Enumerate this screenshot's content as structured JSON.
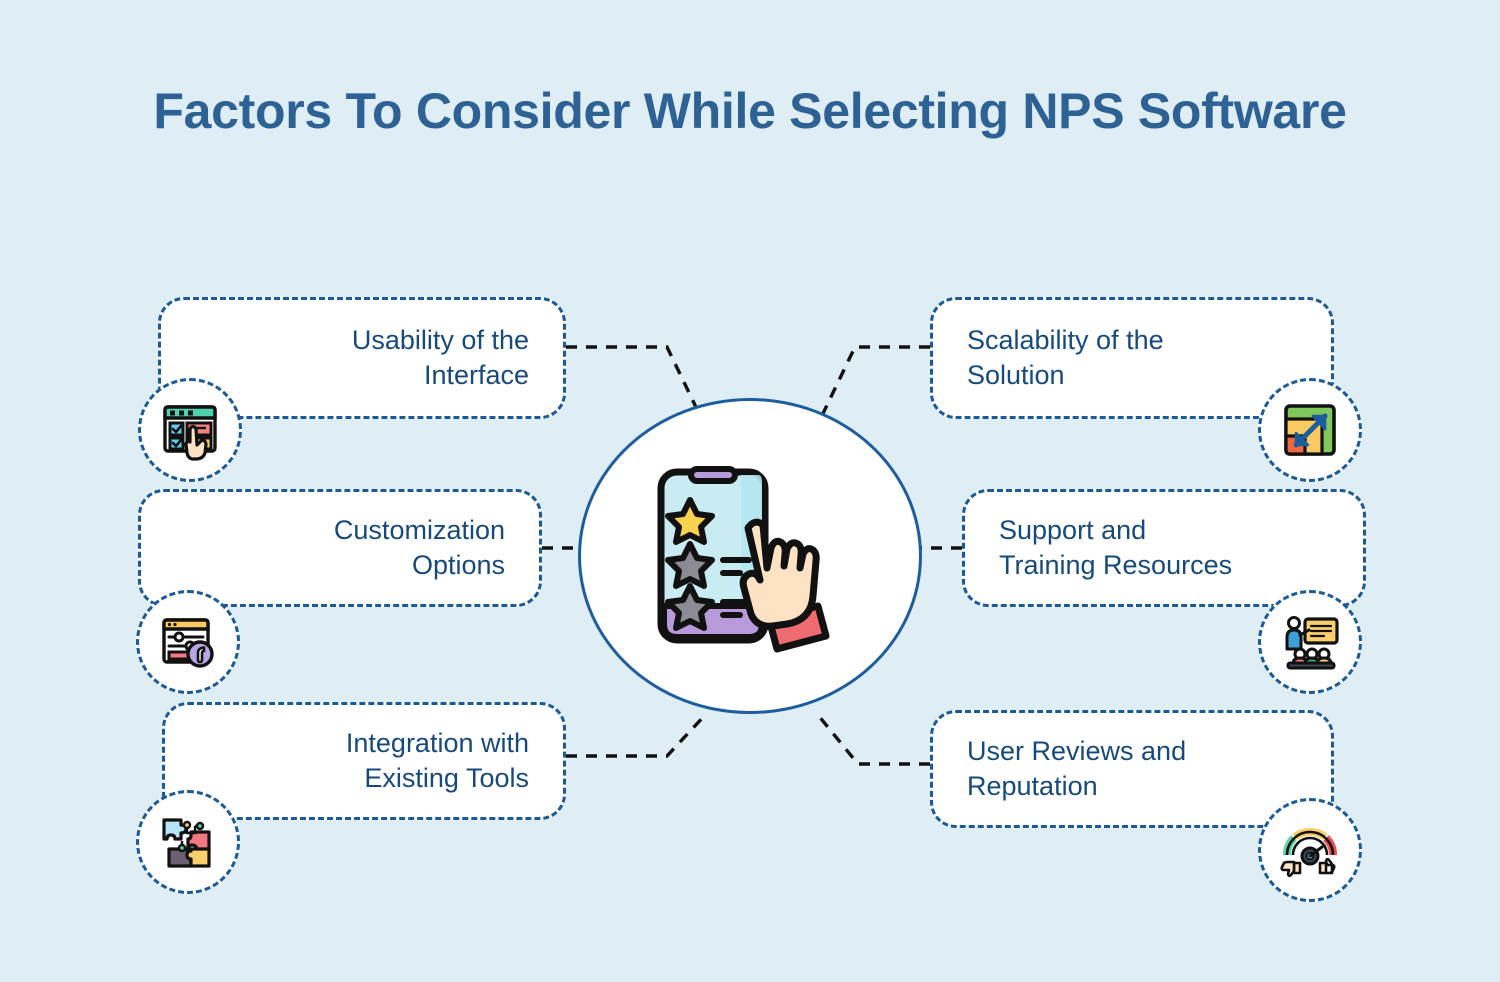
{
  "page": {
    "background_color": "#dfedf5",
    "title": "Factors To Consider While Selecting NPS Software"
  },
  "theme": {
    "title_color": "#2e6294",
    "card_text_color": "#174a7c",
    "border_color": "#1a5a96",
    "circle_border_color": "#1c5d9e",
    "card_fill": "#ffffff",
    "connector_color": "#111111"
  },
  "center": {
    "name": "nps-rating-illustration",
    "icon": "phone-star-rating-hand-icon",
    "description": "Smartphone showing a star rating list with a hand tapping the screen",
    "colors": {
      "phone_screen": "#c9ecf2",
      "phone_bar": "#b69ada",
      "star_filled": "#f8d14f",
      "star_empty": "#8c8a92",
      "hand_skin": "#fde3c4",
      "sleeve": "#ef6b72"
    }
  },
  "factors": {
    "left": [
      {
        "id": "usability",
        "label": "Usability of the Interface",
        "line1": "Usability of the",
        "line2": "Interface",
        "icon": "interface-checklist-cursor-icon"
      },
      {
        "id": "customization",
        "label": "Customization Options",
        "line1": "Customization",
        "line2": "Options",
        "icon": "settings-sliders-wrench-icon"
      },
      {
        "id": "integration",
        "label": "Integration with Existing Tools",
        "line1": "Integration with",
        "line2": "Existing Tools",
        "icon": "puzzle-pieces-integration-icon"
      }
    ],
    "right": [
      {
        "id": "scalability",
        "label": "Scalability of the Solution",
        "line1": "Scalability of the",
        "line2": "Solution",
        "icon": "growth-chart-resize-arrow-icon"
      },
      {
        "id": "support",
        "label": "Support and Training Resources",
        "line1": "Support and",
        "line2": "Training Resources",
        "icon": "training-presentation-audience-icon"
      },
      {
        "id": "reviews",
        "label": "User Reviews and Reputation",
        "line1": "User Reviews and",
        "line2": "Reputation",
        "icon": "reputation-gauge-thumbs-icon"
      }
    ]
  }
}
